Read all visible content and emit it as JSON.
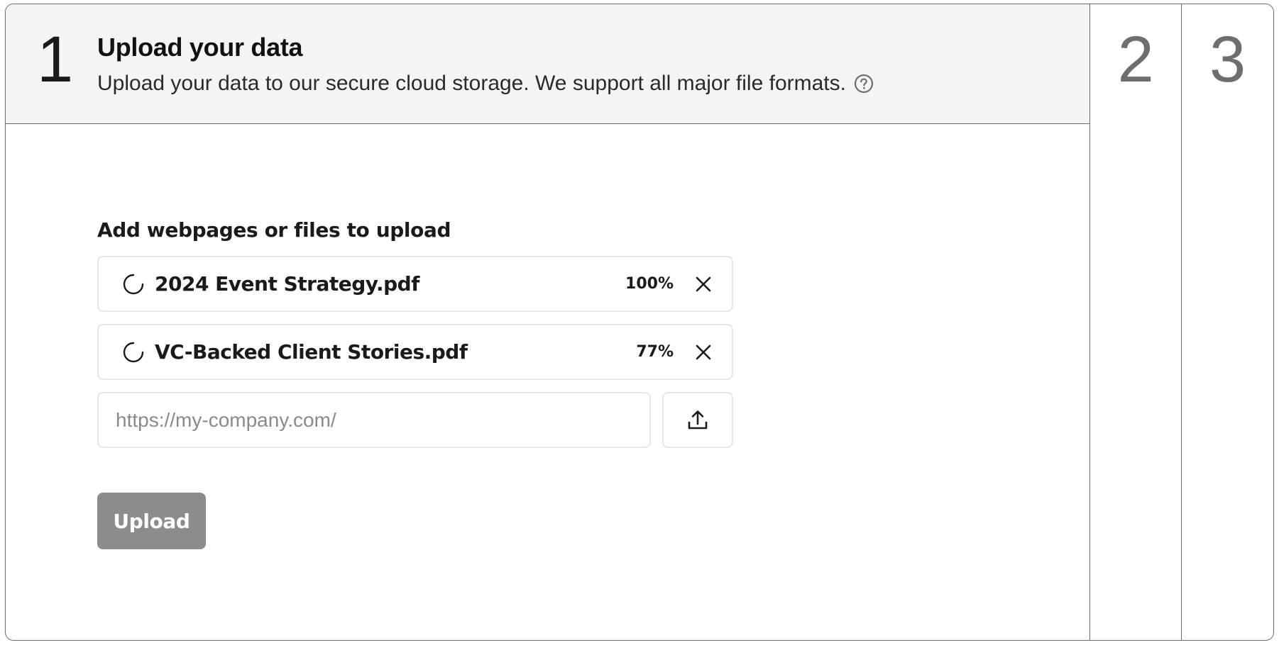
{
  "step1": {
    "number": "1",
    "title": "Upload your data",
    "description": "Upload your data to our secure cloud storage. We support all major file formats.",
    "help_icon": "help-circle-icon",
    "section_label": "Add webpages or files to upload",
    "files": [
      {
        "name": "2024 Event Strategy.pdf",
        "progress": "100%",
        "progress_fraction": 1.0,
        "status_icon": "spinner-icon"
      },
      {
        "name": "VC-Backed Client Stories.pdf",
        "progress": "77%",
        "progress_fraction": 0.77,
        "status_icon": "spinner-icon"
      }
    ],
    "url_input": {
      "value": "",
      "placeholder": "https://my-company.com/"
    },
    "upload_icon": "upload-icon",
    "upload_label": "Upload"
  },
  "step2": {
    "number": "2"
  },
  "step3": {
    "number": "3"
  },
  "colors": {
    "header_bg": "#f4f4f4",
    "border": "#6b6b6b",
    "field_border": "#e6e6e6",
    "button_disabled_bg": "#8c8c8c",
    "collapsed_number": "#6e6e6e"
  }
}
